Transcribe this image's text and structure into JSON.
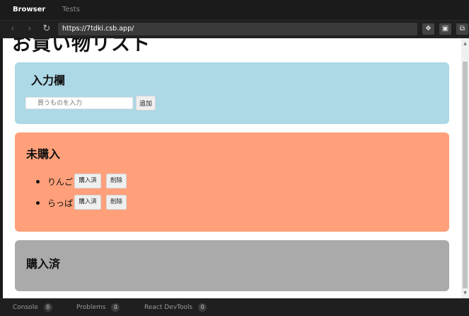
{
  "tabs": [
    {
      "label": "Browser",
      "active": true
    },
    {
      "label": "Tests",
      "active": false
    }
  ],
  "address_bar": {
    "url": "https://7tdki.csb.app/"
  },
  "page": {
    "title": "お買い物リスト",
    "input_section": {
      "heading": "入力欄",
      "placeholder": "買うものを入力",
      "value": "",
      "add_label": "追加",
      "background": "#add8e6"
    },
    "unbought_section": {
      "heading": "未購入",
      "background": "#ffa07a",
      "items": [
        {
          "name": "りんご",
          "bought_label": "購入済",
          "delete_label": "削除"
        },
        {
          "name": "らっぱ",
          "bought_label": "購入済",
          "delete_label": "削除"
        }
      ]
    },
    "bought_section": {
      "heading": "購入済",
      "background": "#aaaaaa",
      "items": []
    }
  },
  "status_bar": [
    {
      "label": "Console",
      "count": "0"
    },
    {
      "label": "Problems",
      "count": "0"
    },
    {
      "label": "React DevTools",
      "count": "0"
    }
  ]
}
